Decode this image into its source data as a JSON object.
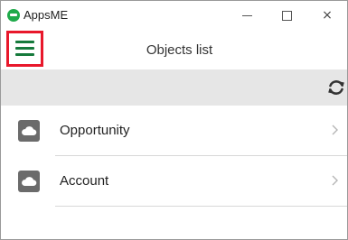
{
  "window": {
    "app_title": "AppsME",
    "controls": {
      "minimize": "minimize",
      "maximize": "maximize",
      "close": "×"
    }
  },
  "header": {
    "title": "Objects list",
    "menu_icon": "hamburger-menu-icon",
    "accent_color": "#167a3c",
    "highlight_color": "#e8182b"
  },
  "toolbar": {
    "refresh_icon": "refresh-icon"
  },
  "list": {
    "items": [
      {
        "label": "Opportunity",
        "icon": "cloud-icon"
      },
      {
        "label": "Account",
        "icon": "cloud-icon"
      }
    ]
  }
}
